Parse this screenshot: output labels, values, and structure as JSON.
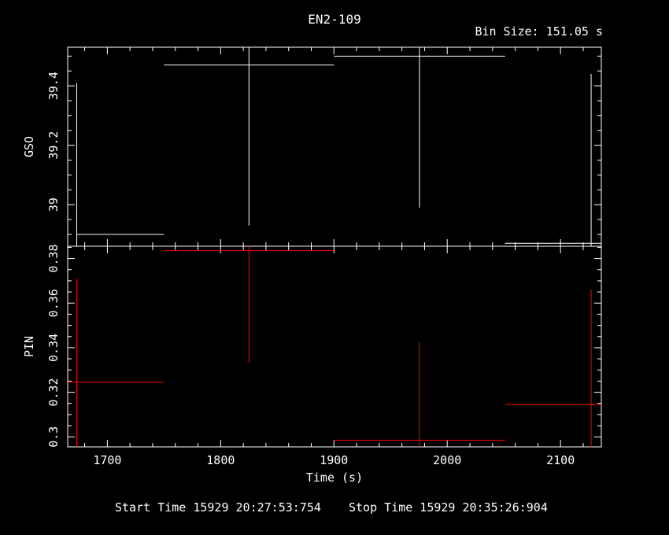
{
  "chart_data": {
    "type": "line",
    "title": "EN2-109",
    "bin_size_label": "Bin Size: 151.05 s",
    "xlabel": "Time (s)",
    "xlim": [
      1665,
      2136
    ],
    "xticks": [
      1700,
      1800,
      1900,
      2000,
      2100
    ],
    "panels": [
      {
        "name": "GSO",
        "ylabel": "GSO",
        "ylim": [
          38.86,
          39.53
        ],
        "yticks": [
          39,
          39.2,
          39.4
        ],
        "ytick_labels": [
          "39",
          "39.2",
          "39.4"
        ],
        "color": "#ffffff",
        "points": [
          {
            "x": 1673.0,
            "xerr_lo": 1673.0,
            "xerr_hi": 1750.0,
            "y": 38.9,
            "yerr_lo": 38.86,
            "yerr_hi": 39.41
          },
          {
            "x": 1825.0,
            "xerr_lo": 1750.0,
            "xerr_hi": 1900.0,
            "y": 39.47,
            "yerr_lo": 38.93,
            "yerr_hi": 39.53
          },
          {
            "x": 1975.5,
            "xerr_lo": 1900.0,
            "xerr_hi": 2051.0,
            "y": 39.5,
            "yerr_lo": 38.99,
            "yerr_hi": 39.53
          },
          {
            "x": 2127.0,
            "xerr_lo": 2051.0,
            "xerr_hi": 2136.0,
            "y": 38.87,
            "yerr_lo": 38.86,
            "yerr_hi": 39.44
          }
        ]
      },
      {
        "name": "PIN",
        "ylabel": "PIN",
        "ylim": [
          0.2955,
          0.3855
        ],
        "yticks": [
          0.3,
          0.32,
          0.34,
          0.36,
          0.38
        ],
        "ytick_labels": [
          "0.3",
          "0.32",
          "0.34",
          "0.36",
          "0.38"
        ],
        "color": "#ff0000",
        "points": [
          {
            "x": 1673.0,
            "xerr_lo": 1665.0,
            "xerr_hi": 1750.0,
            "y": 0.3245,
            "yerr_lo": 0.2955,
            "yerr_hi": 0.371
          },
          {
            "x": 1825.0,
            "xerr_lo": 1750.0,
            "xerr_hi": 1900.0,
            "y": 0.3835,
            "yerr_lo": 0.3333,
            "yerr_hi": 0.3855
          },
          {
            "x": 1975.5,
            "xerr_lo": 1900.0,
            "xerr_hi": 2051.0,
            "y": 0.2985,
            "yerr_lo": 0.2955,
            "yerr_hi": 0.3425
          },
          {
            "x": 2127.0,
            "xerr_lo": 2051.0,
            "xerr_hi": 2136.0,
            "y": 0.3145,
            "yerr_lo": 0.2955,
            "yerr_hi": 0.366
          }
        ]
      }
    ]
  },
  "footer": {
    "start_time": "Start Time 15929 20:27:53:754",
    "stop_time": "Stop Time 15929 20:35:26:904"
  }
}
